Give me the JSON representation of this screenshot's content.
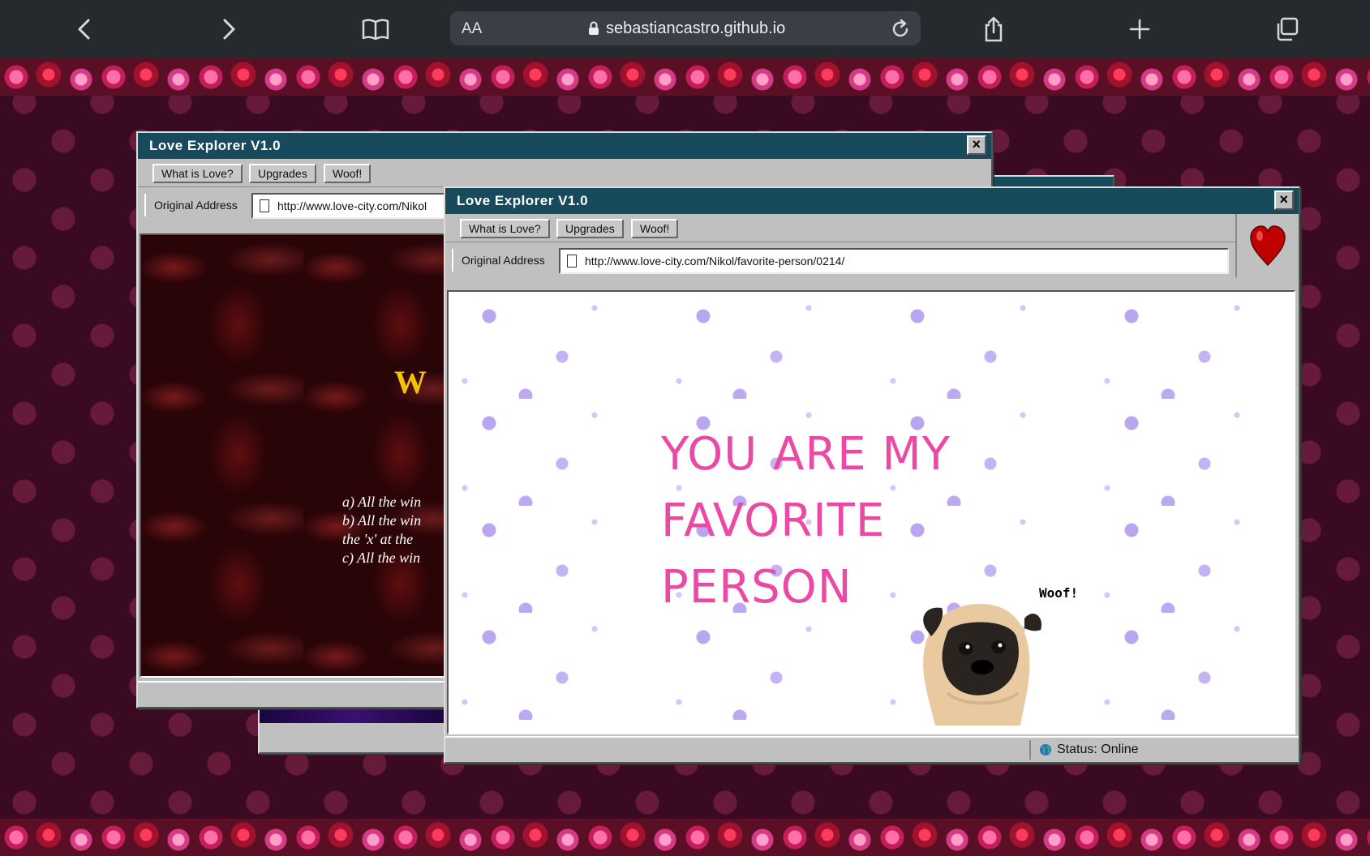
{
  "browser": {
    "text_size_label": "AA",
    "domain": "sebastiancastro.github.io"
  },
  "back_window": {
    "title": "Love Explorer V1.0",
    "buttons": [
      "What is Love?",
      "Upgrades",
      "Woof!"
    ],
    "address_label": "Original Address",
    "address_value": "http://www.love-city.com/Nikol",
    "content_heading_partial": "W",
    "content_lines": [
      "a) All the win",
      "b) All the win",
      "the 'x' at the",
      "c) All the win"
    ]
  },
  "front_window": {
    "title": "Love Explorer V1.0",
    "buttons": [
      "What is Love?",
      "Upgrades",
      "Woof!"
    ],
    "address_label": "Original Address",
    "address_value": "http://www.love-city.com/Nikol/favorite-person/0214/",
    "message_lines": [
      "YOU ARE MY",
      "FAVORITE",
      "PERSON"
    ],
    "woof_caption": "Woof!",
    "status": "Status:  Online"
  },
  "colors": {
    "titlebar": "#174a5a",
    "message": "#ea4aa3",
    "heart": "#c00000"
  },
  "icons": [
    "back-icon",
    "forward-icon",
    "bookmarks-icon",
    "lock-icon",
    "reload-icon",
    "share-icon",
    "new-tab-icon",
    "tabs-icon",
    "heart-icon",
    "globe-icon",
    "document-icon",
    "close-icon"
  ]
}
